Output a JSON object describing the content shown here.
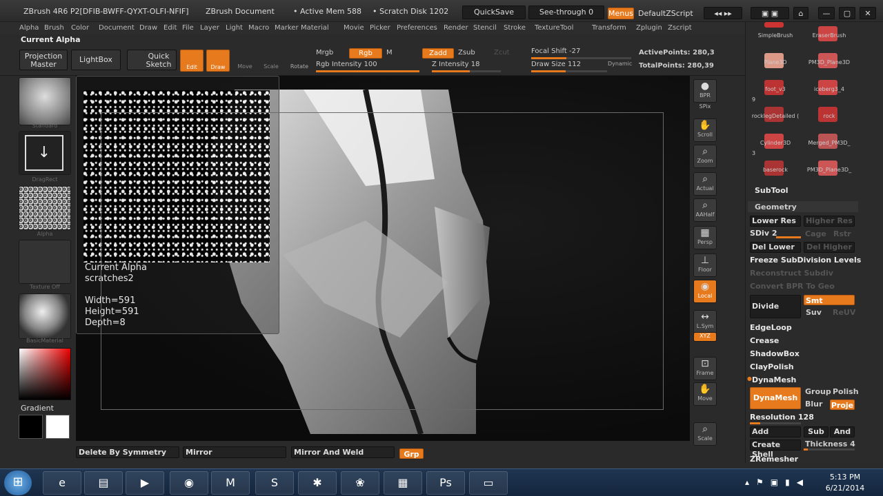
{
  "window": {
    "title_app": "ZBrush 4R6 P2[DFIB-BWFF-QYXT-OLFI-NFIF]",
    "title_doc": "ZBrush Document",
    "active_mem": "• Active Mem 588",
    "scratch_disk": "• Scratch Disk 1202",
    "quicksave": "QuickSave",
    "see_through": "See-through",
    "see_through_val": "0",
    "menus": "Menus",
    "default_script": "DefaultZScript"
  },
  "menu": [
    "Alpha",
    "Brush",
    "Color",
    "Document",
    "Draw",
    "Edit",
    "File",
    "Layer",
    "Light",
    "Macro",
    "Marker",
    "Material",
    "Movie",
    "Picker",
    "Preferences",
    "Render",
    "Stencil",
    "Stroke",
    "Texture",
    "Tool",
    "Transform",
    "Zplugin",
    "Zscript"
  ],
  "toolbar": {
    "current_label": "Current Alpha",
    "projection_master": "Projection Master",
    "lightbox": "LightBox",
    "quick_sketch": "Quick Sketch",
    "edit": "Edit",
    "draw": "Draw",
    "move": "Move",
    "scale": "Scale",
    "rotate": "Rotate",
    "mrgb": "Mrgb",
    "rgb": "Rgb",
    "m": "M",
    "zadd": "Zadd",
    "zsub": "Zsub",
    "zcut": "Zcut",
    "rgb_intensity": "Rgb Intensity 100",
    "z_intensity": "Z Intensity 18",
    "focal_shift": "Focal Shift -27",
    "draw_size": "Draw Size 112",
    "dynamic": "Dynamic",
    "active_points": "ActivePoints: 280,3",
    "total_points": "TotalPoints: 280,39"
  },
  "left_shelf": {
    "brush_caption": "Standard",
    "stroke_caption": "DragRect",
    "alpha_caption": "Alpha",
    "texture_caption": "Texture Off",
    "material_caption": "BasicMaterial",
    "gradient_label": "Gradient"
  },
  "tooltip": {
    "title": "Current Alpha",
    "name": "scratches2",
    "width": "Width=591",
    "height": "Height=591",
    "depth": "Depth=8"
  },
  "right_shelf": [
    "BPR",
    "SPix",
    "Scroll",
    "Zoom",
    "Actual",
    "AAHalf",
    "Persp",
    "Floor",
    "Local",
    "L.Sym",
    "XYZ",
    "Frame",
    "Move",
    "Scale"
  ],
  "tray": {
    "tools": [
      {
        "name": "SimpleBrush"
      },
      {
        "name": "EraserBrush"
      },
      {
        "name": "Plane3D"
      },
      {
        "name": "PM3D_Plane3D"
      },
      {
        "name": "foot_v3"
      },
      {
        "name": "iceberg3_4"
      },
      {
        "name": "rocklegDetailed ("
      },
      {
        "name": "rock"
      },
      {
        "name": "Cylinder3D"
      },
      {
        "name": "Merged_PM3D_"
      },
      {
        "name": "baserock"
      },
      {
        "name": "PM3D_Plane3D_"
      }
    ],
    "counts": [
      "9",
      "3"
    ],
    "subtool": "SubTool",
    "geometry": "Geometry",
    "lower_res": "Lower Res",
    "higher_res": "Higher Res",
    "sdiv": "SDiv 2",
    "cage": "Cage",
    "rstr": "Rstr",
    "del_lower": "Del Lower",
    "del_higher": "Del Higher",
    "freeze": "Freeze SubDivision Levels",
    "reconstruct": "Reconstruct Subdiv",
    "convert_bpr": "Convert BPR To Geo",
    "divide": "Divide",
    "smt": "Smt",
    "suv": "Suv",
    "reuv": "ReUV",
    "edgeloop": "EdgeLoop",
    "crease": "Crease",
    "shadowbox": "ShadowBox",
    "claypolish": "ClayPolish",
    "dynamesh_header": "DynaMesh",
    "dynamesh": "DynaMesh",
    "group": "Group",
    "polish": "Polish",
    "blur": "Blur",
    "proje": "Proje",
    "resolution": "Resolution 128",
    "add": "Add",
    "sub": "Sub",
    "and": "And",
    "create_shell": "Create Shell",
    "thickness": "Thickness 4",
    "zremesher": "ZRemesher"
  },
  "bottom": {
    "delete_by_symmetry": "Delete By Symmetry",
    "mirror": "Mirror",
    "mirror_and_weld": "Mirror And Weld",
    "grp": "Grp"
  },
  "taskbar": {
    "time": "5:13 PM",
    "date": "6/21/2014"
  }
}
